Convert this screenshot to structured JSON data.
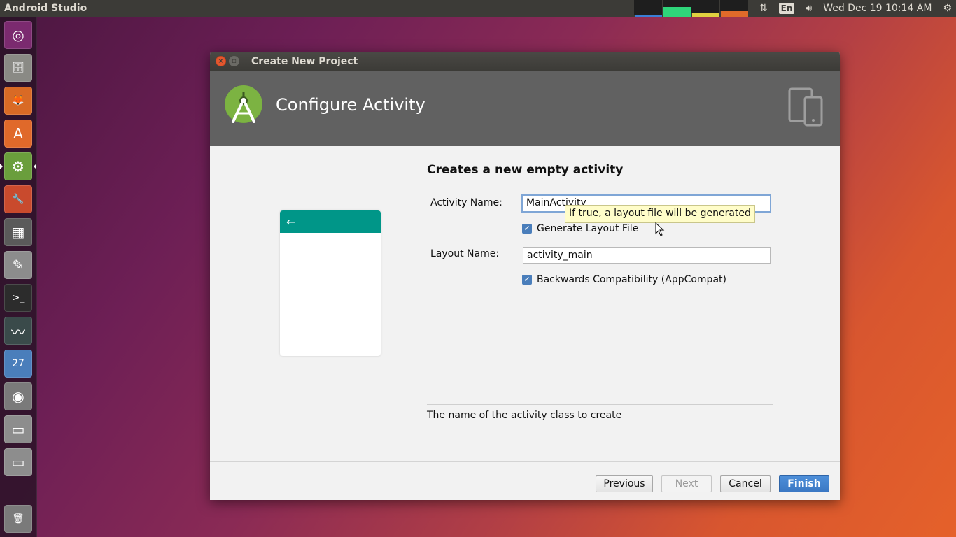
{
  "top_panel": {
    "app_title": "Android Studio",
    "keyboard_layout": "En",
    "datetime": "Wed Dec 19 10:14 AM"
  },
  "launcher": {
    "items": [
      {
        "name": "ubuntu-dash-icon",
        "glyph": "◎",
        "color": "#7b2a6f"
      },
      {
        "name": "files-icon",
        "glyph": "🗄",
        "color": "#8a8a85"
      },
      {
        "name": "firefox-icon",
        "glyph": "🦊",
        "color": "#d96a25"
      },
      {
        "name": "software-center-icon",
        "glyph": "A",
        "color": "#e0692a"
      },
      {
        "name": "android-studio-icon",
        "glyph": "⚙",
        "color": "#6a9e3c"
      },
      {
        "name": "system-settings-icon",
        "glyph": "🔧",
        "color": "#c94a2d"
      },
      {
        "name": "calculator-icon",
        "glyph": "▦",
        "color": "#5a5a5a"
      },
      {
        "name": "text-editor-icon",
        "glyph": "✎",
        "color": "#8c8c8c"
      },
      {
        "name": "terminal-icon",
        "glyph": ">_",
        "color": "#2c2c2c"
      },
      {
        "name": "system-monitor-icon",
        "glyph": "〰",
        "color": "#3a4a4a"
      },
      {
        "name": "calendar-icon",
        "glyph": "27",
        "color": "#4a7ebb"
      },
      {
        "name": "screenshot-icon",
        "glyph": "◉",
        "color": "#7a7a7a"
      },
      {
        "name": "drive-icon",
        "glyph": "▭",
        "color": "#8d8d8d"
      },
      {
        "name": "drive-icon-2",
        "glyph": "▭",
        "color": "#8d8d8d"
      },
      {
        "name": "trash-icon",
        "glyph": "🗑",
        "color": "#7a7a7a"
      }
    ]
  },
  "dialog": {
    "window_title": "Create New Project",
    "header_title": "Configure Activity",
    "heading": "Creates a new empty activity",
    "activity_name_label": "Activity Name:",
    "activity_name_value": "MainActivity",
    "tooltip": "If true, a layout file will be generated",
    "generate_layout_label": "Generate Layout File",
    "generate_layout_checked": true,
    "layout_name_label": "Layout Name:",
    "layout_name_value": "activity_main",
    "backwards_compat_label": "Backwards Compatibility (AppCompat)",
    "backwards_compat_checked": true,
    "description": "The name of the activity class to create",
    "preview_back_arrow": "←",
    "buttons": {
      "previous": "Previous",
      "next": "Next",
      "cancel": "Cancel",
      "finish": "Finish"
    }
  },
  "colors": {
    "preview_toolbar": "#009688",
    "header_bg": "#616161",
    "primary_button": "#3b78c4"
  }
}
